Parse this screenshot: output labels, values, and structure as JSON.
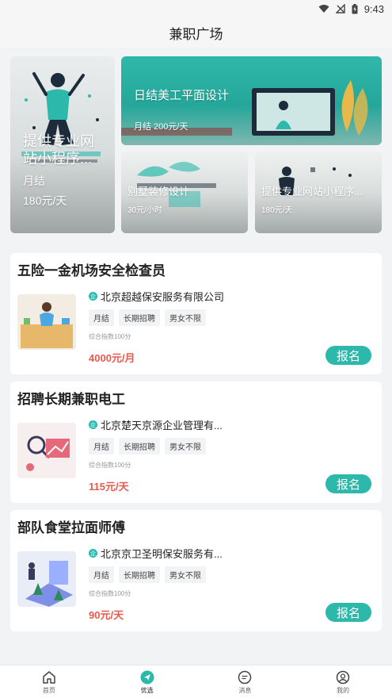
{
  "status": {
    "time": "9:43"
  },
  "header": {
    "title": "兼职广场"
  },
  "banners": {
    "big": {
      "title": "提供专业网站小程序...",
      "line1": "月结",
      "line2": "180元/天"
    },
    "top": {
      "title": "日结美工平面设计",
      "sub": "月结  200元/天"
    },
    "small1": {
      "title": "别墅装修设计",
      "sub": "30元/小时"
    },
    "small2": {
      "title": "提供专业网站小程序...",
      "sub": "180元/天"
    }
  },
  "jobs": [
    {
      "title": "五险一金机场安全检查员",
      "company": "北京超越保安服务有限公司",
      "tags": [
        "月结",
        "长期招聘",
        "男女不限"
      ],
      "score": "综合指数100分",
      "salary": "4000元/月",
      "apply": "报名"
    },
    {
      "title": "招聘长期兼职电工",
      "company": "北京楚天京源企业管理有...",
      "tags": [
        "月结",
        "长期招聘",
        "男女不限"
      ],
      "score": "综合指数100分",
      "salary": "115元/天",
      "apply": "报名"
    },
    {
      "title": "部队食堂拉面师傅",
      "company": "北京京卫圣明保安服务有...",
      "tags": [
        "月结",
        "长期招聘",
        "男女不限"
      ],
      "score": "综合指数100分",
      "salary": "90元/天",
      "apply": "报名"
    }
  ],
  "company_badge": "企",
  "tabs": [
    {
      "label": "首页",
      "icon": "home-icon"
    },
    {
      "label": "优选",
      "icon": "send-icon"
    },
    {
      "label": "消息",
      "icon": "message-icon"
    },
    {
      "label": "我的",
      "icon": "user-icon"
    }
  ],
  "colors": {
    "accent": "#2cb9ab",
    "salary": "#e85a4f",
    "background": "#f2f3f5"
  }
}
